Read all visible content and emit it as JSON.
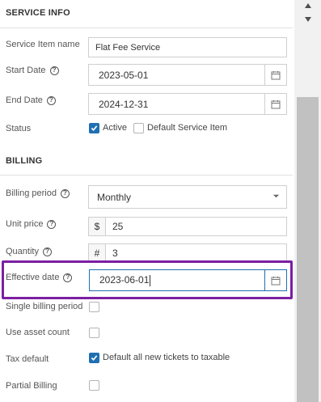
{
  "service_info": {
    "heading": "SERVICE INFO",
    "service_item_name": {
      "label": "Service Item name",
      "value": "Flat Fee Service"
    },
    "start_date": {
      "label": "Start Date",
      "value": "2023-05-01"
    },
    "end_date": {
      "label": "End Date",
      "value": "2024-12-31"
    },
    "status": {
      "label": "Status",
      "active": {
        "label": "Active",
        "checked": true
      },
      "default_service_item": {
        "label": "Default Service Item",
        "checked": false
      }
    }
  },
  "billing": {
    "heading": "BILLING",
    "billing_period": {
      "label": "Billing period",
      "value": "Monthly"
    },
    "unit_price": {
      "label": "Unit price",
      "prefix": "$",
      "value": "25"
    },
    "quantity": {
      "label": "Quantity",
      "prefix": "#",
      "value": "3"
    },
    "effective_date": {
      "label": "Effective date",
      "value": "2023-06-01"
    },
    "single_billing_period": {
      "label": "Single billing period",
      "checked": false
    },
    "use_asset_count": {
      "label": "Use asset count",
      "checked": false
    },
    "tax_default": {
      "label": "Tax default",
      "checkbox_label": "Default all new tickets to taxable",
      "checked": true
    },
    "partial_billing": {
      "label": "Partial Billing",
      "checked": false
    }
  },
  "icons": {
    "help": "question-circle-icon",
    "calendar": "calendar-icon",
    "dropdown": "chevron-down-icon",
    "check": "checkmark-icon"
  },
  "colors": {
    "accent": "#1f6fb2",
    "highlight": "#7b1fa2",
    "focus_border": "#1f6fb2"
  }
}
